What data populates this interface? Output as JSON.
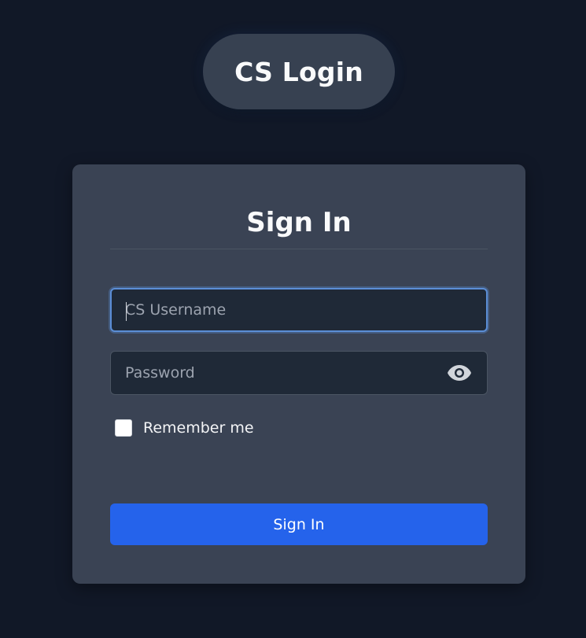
{
  "app": {
    "title": "CS Login"
  },
  "card": {
    "title": "Sign In"
  },
  "form": {
    "username": {
      "value": "",
      "placeholder": "CS Username"
    },
    "password": {
      "value": "",
      "placeholder": "Password",
      "toggle_icon": "eye-icon"
    },
    "remember": {
      "label": "Remember me",
      "checked": false
    },
    "submit_label": "Sign In"
  },
  "colors": {
    "page_background": "#111827",
    "card_background": "#3a4354",
    "input_background": "#1f2937",
    "focus_ring": "#5b8ed6",
    "primary_button": "#2563eb"
  }
}
